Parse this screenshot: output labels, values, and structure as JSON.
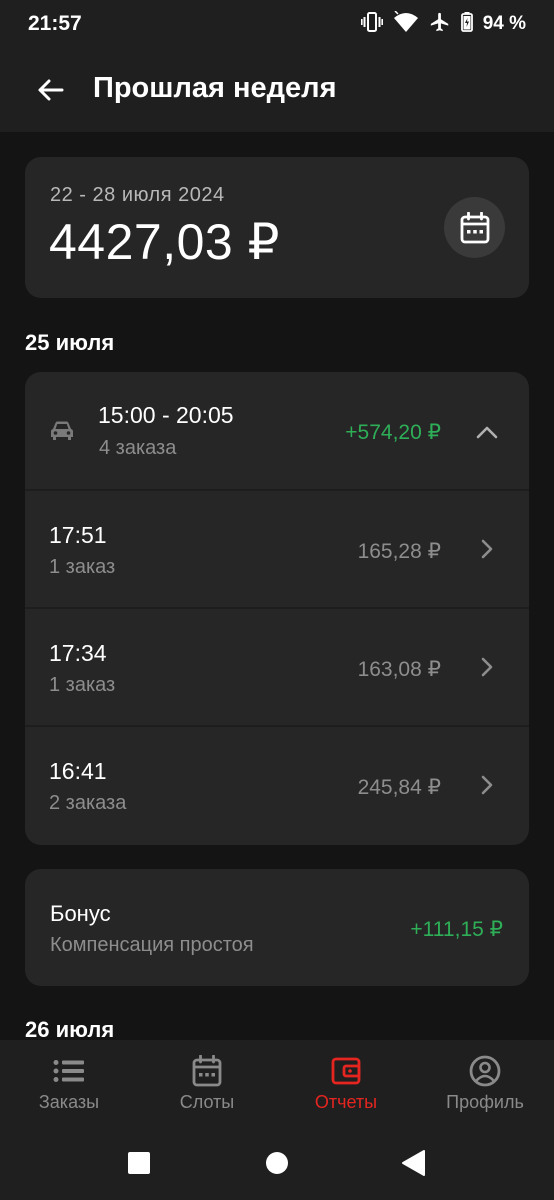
{
  "status_bar": {
    "time": "21:57",
    "battery_text": "94 %",
    "icons": [
      "vibrate-icon",
      "wifi-icon",
      "airplane-icon",
      "battery-icon"
    ]
  },
  "app_bar": {
    "title": "Прошлая неделя",
    "back_icon": "arrow-left-icon"
  },
  "summary": {
    "date_range": "22 - 28 июля 2024",
    "total": "4427,03 ₽",
    "calendar_icon": "calendar-icon"
  },
  "days": [
    {
      "date": "25 июля",
      "shift": {
        "time_range": "15:00 - 20:05",
        "orders": "4 заказа",
        "amount": "+574,20 ₽",
        "icon": "car-icon",
        "expand_icon": "chevron-up-icon"
      },
      "entries": [
        {
          "time": "17:51",
          "orders": "1 заказ",
          "amount": "165,28 ₽"
        },
        {
          "time": "17:34",
          "orders": "1 заказ",
          "amount": "163,08 ₽"
        },
        {
          "time": "16:41",
          "orders": "2 заказа",
          "amount": "245,84 ₽"
        }
      ],
      "bonus": {
        "title": "Бонус",
        "subtitle": "Компенсация простоя",
        "amount": "+111,15 ₽"
      }
    },
    {
      "date": "26 июля"
    }
  ],
  "bottom_nav": {
    "items": [
      {
        "label": "Заказы",
        "icon": "list-icon",
        "active": false
      },
      {
        "label": "Слоты",
        "icon": "calendar-icon",
        "active": false
      },
      {
        "label": "Отчеты",
        "icon": "wallet-icon",
        "active": true
      },
      {
        "label": "Профиль",
        "icon": "profile-icon",
        "active": false
      }
    ]
  },
  "colors": {
    "background": "#141414",
    "card": "#262626",
    "accent": "#e52520",
    "positive": "#2fae58",
    "secondary_text": "#8d8d8d"
  }
}
